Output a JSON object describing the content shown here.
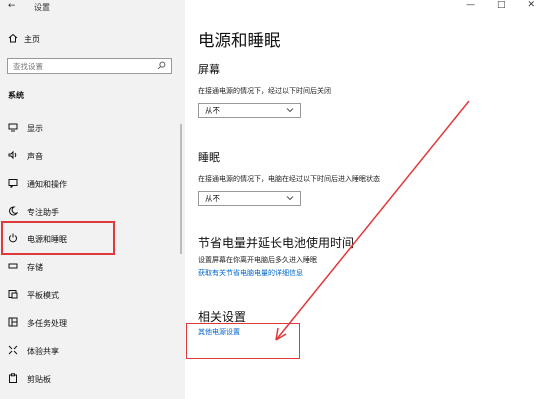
{
  "window": {
    "title": "设置",
    "back_glyph": "←",
    "controls": [
      "—",
      "□",
      "✕"
    ]
  },
  "sidebar": {
    "home_label": "主页",
    "search_placeholder": "查找设置",
    "section_title": "系统",
    "items": [
      {
        "label": "显示",
        "icon": "display-icon"
      },
      {
        "label": "声音",
        "icon": "sound-icon"
      },
      {
        "label": "通知和操作",
        "icon": "notification-icon"
      },
      {
        "label": "专注助手",
        "icon": "moon-icon"
      },
      {
        "label": "电源和睡眠",
        "icon": "power-icon"
      },
      {
        "label": "存储",
        "icon": "storage-icon"
      },
      {
        "label": "平板模式",
        "icon": "tablet-icon"
      },
      {
        "label": "多任务处理",
        "icon": "multitask-icon"
      },
      {
        "label": "体验共享",
        "icon": "share-icon"
      },
      {
        "label": "剪贴板",
        "icon": "clipboard-icon"
      }
    ]
  },
  "main": {
    "title": "电源和睡眠",
    "screen": {
      "heading": "屏幕",
      "description": "在接通电源的情况下，经过以下时间后关闭",
      "select_value": "从不"
    },
    "sleep": {
      "heading": "睡眠",
      "description": "在接通电源的情况下，电脑在经过以下时间后进入睡眠状态",
      "select_value": "从不"
    },
    "battery": {
      "heading": "节省电量并延长电池使用时间",
      "description": "设置屏幕在你离开电脑后多久进入睡眠",
      "link": "获取有关节省电脑电量的详细信息"
    },
    "related": {
      "heading": "相关设置",
      "link": "其他电源设置"
    }
  },
  "annotation": {
    "color": "#e0393b"
  }
}
